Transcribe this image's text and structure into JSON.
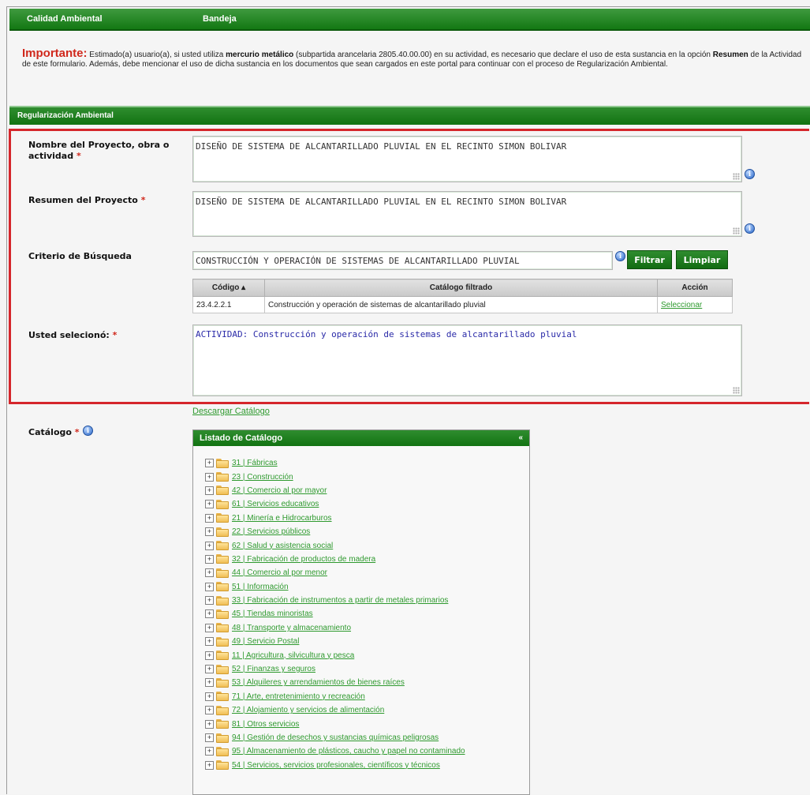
{
  "topbar": {
    "left": "Calidad Ambiental",
    "right": "Bandeja"
  },
  "notice": {
    "important": "Importante:",
    "text1": " Estimado(a) usuario(a), si usted utiliza ",
    "bold1": "mercurio metálico",
    "text2": " (subpartida arancelaria 2805.40.00.00) en su actividad, es necesario que declare el uso de esta sustancia en la opción ",
    "bold2": "Resumen",
    "text3": " de la Actividad de este formulario. Además, debe mencionar el uso de dicha sustancia en los documentos que sean cargados en este portal para continuar con el proceso de Regularización Ambiental."
  },
  "section": {
    "title": "Regularización Ambiental"
  },
  "form": {
    "project_name_label": "Nombre del Proyecto, obra o actividad",
    "project_name_value": "DISEÑO DE SISTEMA DE ALCANTARILLADO PLUVIAL EN EL RECINTO SIMON BOLIVAR",
    "summary_label": "Resumen del Proyecto",
    "summary_value": "DISEÑO DE SISTEMA DE ALCANTARILLADO PLUVIAL EN EL RECINTO SIMON BOLIVAR",
    "criteria_label": "Criterio de Búsqueda",
    "criteria_value": "CONSTRUCCIÓN Y OPERACIÓN DE SISTEMAS DE ALCANTARILLADO PLUVIAL",
    "filter_button": "Filtrar",
    "clear_button": "Limpiar",
    "required_mark": "*",
    "selected_label": "Usted selecionó:",
    "selected_value": "ACTIVIDAD: Construcción y operación de sistemas de alcantarillado pluvial"
  },
  "results": {
    "headers": [
      "Código ▴",
      "Catálogo filtrado",
      "Acción"
    ],
    "rows": [
      [
        "23.4.2.2.1",
        "Construcción y operación de sistemas de alcantarillado pluvial",
        "Seleccionar"
      ]
    ]
  },
  "catalog": {
    "label": "Catálogo",
    "download_link": "Descargar Catálogo",
    "panel_title": "Listado de Catálogo",
    "collapse_icon": "chevron-left-icon",
    "items": [
      "31 | Fábricas",
      "23 | Construcción",
      "42 | Comercio al por mayor",
      "61 | Servicios educativos",
      "21 | Minería e Hidrocarburos",
      "22 | Servicios públicos",
      "62 | Salud y asistencia social",
      "32 | Fabricación de productos de madera",
      "44 | Comercio al por menor",
      "51 | Información",
      "33 | Fabricación de instrumentos a partir de metales primarios",
      "45 | Tiendas minoristas",
      "48 | Transporte y almacenamiento",
      "49 | Servicio Postal",
      "11 | Agricultura, silvicultura y pesca",
      "52 | Finanzas y seguros",
      "53 | Alquileres y arrendamientos de bienes raíces",
      "71 | Arte, entretenimiento y recreación",
      "72 | Alojamiento y servicios de alimentación",
      "81 | Otros servicios",
      "94 | Gestión de desechos y sustancias químicas peligrosas",
      "95 | Almacenamiento de plásticos, caucho y papel no contaminado",
      "54 | Servicios, servicios profesionales, científicos y técnicos"
    ]
  },
  "colors": {
    "brand_green": "#137813",
    "required_red": "#d0281c",
    "link_green": "#2f9a2f",
    "highlight_red": "#d5262b"
  }
}
